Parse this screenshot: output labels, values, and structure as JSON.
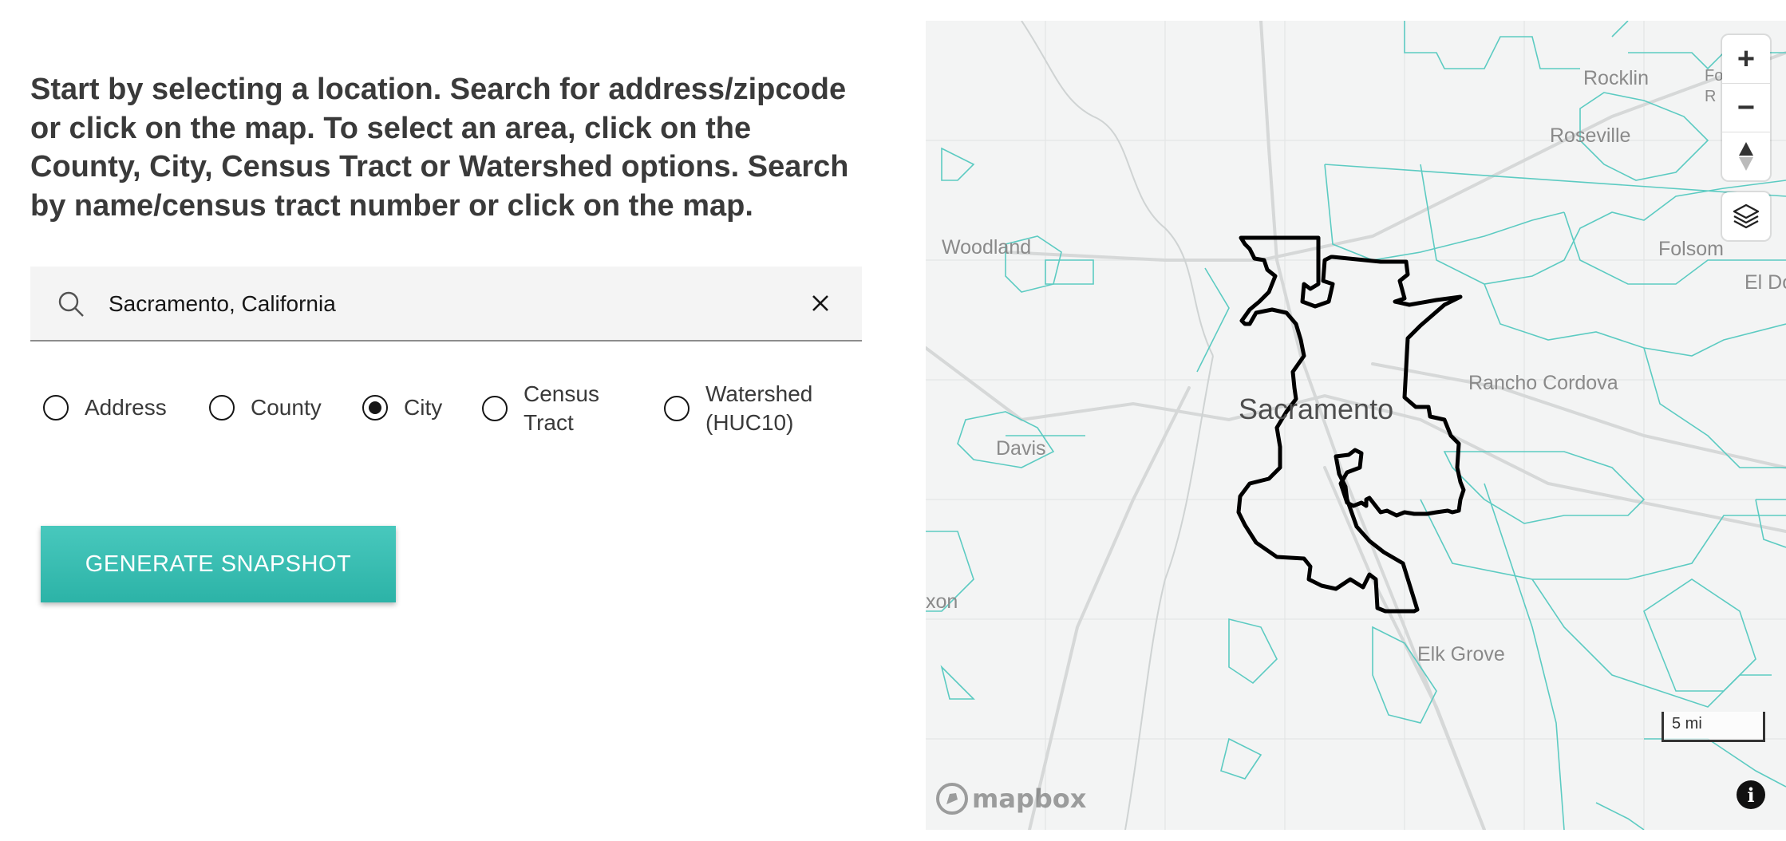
{
  "intro": {
    "text": "Start by selecting a location. Search for address/zipcode or click on the map. To select an area, click on the County, City, Census Tract or Watershed options. Search by name/census tract number or click on the map."
  },
  "search": {
    "value": "Sacramento, California",
    "search_icon": "search-icon",
    "clear_icon": "close-icon"
  },
  "location_types": {
    "options": [
      {
        "line1": "Address",
        "line2": "",
        "selected": false
      },
      {
        "line1": "County",
        "line2": "",
        "selected": false
      },
      {
        "line1": "City",
        "line2": "",
        "selected": true
      },
      {
        "line1": "Census",
        "line2": "Tract",
        "selected": false
      },
      {
        "line1": "Watershed",
        "line2": "(HUC10)",
        "selected": false
      }
    ]
  },
  "actions": {
    "generate_label": "GENERATE SNAPSHOT",
    "accent_color": "#36bdb1"
  },
  "map": {
    "places": {
      "sacramento": "Sacramento",
      "rocklin": "Rocklin",
      "roseville": "Roseville",
      "woodland": "Woodland",
      "folsom": "Folsom",
      "el_dorado": "El Do",
      "rancho_cordova": "Rancho Cordova",
      "davis": "Davis",
      "dixon": "xon",
      "elk_grove": "Elk Grove",
      "fo_top": "Fo",
      "fo_bottom": "R"
    },
    "controls": {
      "zoom_in": "+",
      "zoom_out": "−",
      "compass_icon": "compass-icon",
      "layers_icon": "layers-icon",
      "info": "i"
    },
    "scale_label": "5 mi",
    "attribution_logo": "mapbox",
    "boundary_color": "#5ccbc2",
    "selection_color": "#000000"
  }
}
